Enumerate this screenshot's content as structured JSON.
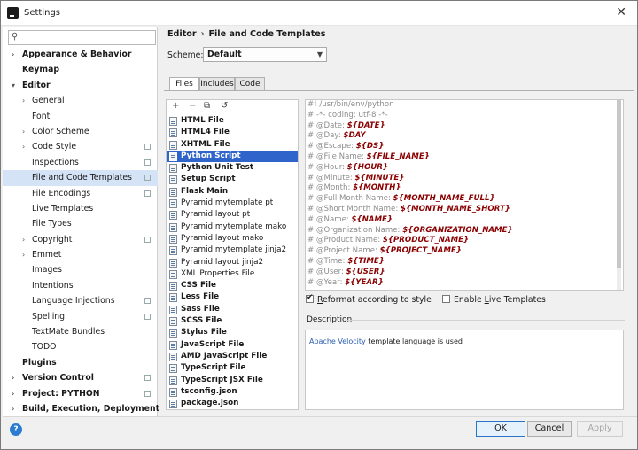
{
  "window": {
    "title": "Settings"
  },
  "search": {
    "placeholder": ""
  },
  "tree": [
    {
      "label": "Appearance & Behavior",
      "level": 0,
      "bold": true,
      "arrow": true,
      "proj": false
    },
    {
      "label": "Keymap",
      "level": 0,
      "bold": true,
      "arrow": false,
      "proj": false
    },
    {
      "label": "Editor",
      "level": 0,
      "bold": true,
      "arrow": "open",
      "proj": false
    },
    {
      "label": "General",
      "level": 1,
      "bold": false,
      "arrow": true,
      "proj": false
    },
    {
      "label": "Font",
      "level": 1,
      "bold": false,
      "arrow": false,
      "proj": false
    },
    {
      "label": "Color Scheme",
      "level": 1,
      "bold": false,
      "arrow": true,
      "proj": false
    },
    {
      "label": "Code Style",
      "level": 1,
      "bold": false,
      "arrow": true,
      "proj": true
    },
    {
      "label": "Inspections",
      "level": 1,
      "bold": false,
      "arrow": false,
      "proj": true
    },
    {
      "label": "File and Code Templates",
      "level": 1,
      "bold": false,
      "arrow": false,
      "proj": true,
      "selected": true
    },
    {
      "label": "File Encodings",
      "level": 1,
      "bold": false,
      "arrow": false,
      "proj": true
    },
    {
      "label": "Live Templates",
      "level": 1,
      "bold": false,
      "arrow": false,
      "proj": false
    },
    {
      "label": "File Types",
      "level": 1,
      "bold": false,
      "arrow": false,
      "proj": false
    },
    {
      "label": "Copyright",
      "level": 1,
      "bold": false,
      "arrow": true,
      "proj": true
    },
    {
      "label": "Emmet",
      "level": 1,
      "bold": false,
      "arrow": true,
      "proj": false
    },
    {
      "label": "Images",
      "level": 1,
      "bold": false,
      "arrow": false,
      "proj": false
    },
    {
      "label": "Intentions",
      "level": 1,
      "bold": false,
      "arrow": false,
      "proj": false
    },
    {
      "label": "Language Injections",
      "level": 1,
      "bold": false,
      "arrow": false,
      "proj": true
    },
    {
      "label": "Spelling",
      "level": 1,
      "bold": false,
      "arrow": false,
      "proj": true
    },
    {
      "label": "TextMate Bundles",
      "level": 1,
      "bold": false,
      "arrow": false,
      "proj": false
    },
    {
      "label": "TODO",
      "level": 1,
      "bold": false,
      "arrow": false,
      "proj": false
    },
    {
      "label": "Plugins",
      "level": 0,
      "bold": true,
      "arrow": false,
      "proj": false
    },
    {
      "label": "Version Control",
      "level": 0,
      "bold": true,
      "arrow": true,
      "proj": true
    },
    {
      "label": "Project: PYTHON",
      "level": 0,
      "bold": true,
      "arrow": true,
      "proj": true
    },
    {
      "label": "Build, Execution, Deployment",
      "level": 0,
      "bold": true,
      "arrow": true,
      "proj": false
    }
  ],
  "breadcrumb": {
    "parent": "Editor",
    "sep": "›",
    "current": "File and Code Templates"
  },
  "scheme": {
    "label": "Scheme:",
    "value": "Default"
  },
  "tabs": [
    {
      "label": "Files",
      "active": true
    },
    {
      "label": "Includes",
      "active": false
    },
    {
      "label": "Code",
      "active": false
    }
  ],
  "toolbar": {
    "add": "+",
    "remove": "−",
    "copy": "⧉",
    "reset": "↺"
  },
  "files": [
    {
      "name": "HTML File",
      "bold": true
    },
    {
      "name": "HTML4 File",
      "bold": true
    },
    {
      "name": "XHTML File",
      "bold": true
    },
    {
      "name": "Python Script",
      "bold": true,
      "selected": true
    },
    {
      "name": "Python Unit Test",
      "bold": true
    },
    {
      "name": "Setup Script",
      "bold": true
    },
    {
      "name": "Flask Main",
      "bold": true
    },
    {
      "name": "Pyramid mytemplate pt",
      "bold": false
    },
    {
      "name": "Pyramid layout pt",
      "bold": false
    },
    {
      "name": "Pyramid mytemplate mako",
      "bold": false
    },
    {
      "name": "Pyramid layout mako",
      "bold": false
    },
    {
      "name": "Pyramid mytemplate jinja2",
      "bold": false
    },
    {
      "name": "Pyramid layout jinja2",
      "bold": false
    },
    {
      "name": "XML Properties File",
      "bold": false
    },
    {
      "name": "CSS File",
      "bold": true
    },
    {
      "name": "Less File",
      "bold": true
    },
    {
      "name": "Sass File",
      "bold": true
    },
    {
      "name": "SCSS File",
      "bold": true
    },
    {
      "name": "Stylus File",
      "bold": true
    },
    {
      "name": "JavaScript File",
      "bold": true
    },
    {
      "name": "AMD JavaScript File",
      "bold": true
    },
    {
      "name": "TypeScript File",
      "bold": true
    },
    {
      "name": "TypeScript JSX File",
      "bold": true
    },
    {
      "name": "tsconfig.json",
      "bold": true
    },
    {
      "name": "package.json",
      "bold": true
    }
  ],
  "code": [
    {
      "text": "#! /usr/bin/env/python",
      "var": ""
    },
    {
      "text": "# -*- coding: utf-8 -*-",
      "var": ""
    },
    {
      "text": "# @Date: ",
      "var": "${DATE}"
    },
    {
      "text": "# @Day: ",
      "var": "$DAY"
    },
    {
      "text": "# @Escape: ",
      "var": "${DS}"
    },
    {
      "text": "# @File Name: ",
      "var": "${FILE_NAME}"
    },
    {
      "text": "# @Hour: ",
      "var": "${HOUR}"
    },
    {
      "text": "# @Minute: ",
      "var": "${MINUTE}"
    },
    {
      "text": "# @Month: ",
      "var": "${MONTH}"
    },
    {
      "text": "# @Full Month Name: ",
      "var": "${MONTH_NAME_FULL}"
    },
    {
      "text": "# @Short Month Name: ",
      "var": "${MONTH_NAME_SHORT}"
    },
    {
      "text": "# @Name: ",
      "var": "${NAME}"
    },
    {
      "text": "# @Organization Name: ",
      "var": "${ORGANIZATION_NAME}"
    },
    {
      "text": "# @Product Name: ",
      "var": "${PRODUCT_NAME}"
    },
    {
      "text": "# @Project Name: ",
      "var": "${PROJECT_NAME}"
    },
    {
      "text": "# @Time: ",
      "var": "${TIME}"
    },
    {
      "text": "# @User: ",
      "var": "${USER}"
    },
    {
      "text": "# @Year: ",
      "var": "${YEAR}"
    }
  ],
  "options": {
    "reformat_pre": "R",
    "reformat_rest": "eformat according to style",
    "reformat_checked": true,
    "live_pre": "Enable ",
    "live_u": "L",
    "live_rest": "ive Templates",
    "live_checked": false
  },
  "description": {
    "title": "Description",
    "link": "Apache Velocity",
    "text": " template language is used"
  },
  "buttons": {
    "help": "?",
    "ok": "OK",
    "cancel": "Cancel",
    "apply": "Apply"
  }
}
